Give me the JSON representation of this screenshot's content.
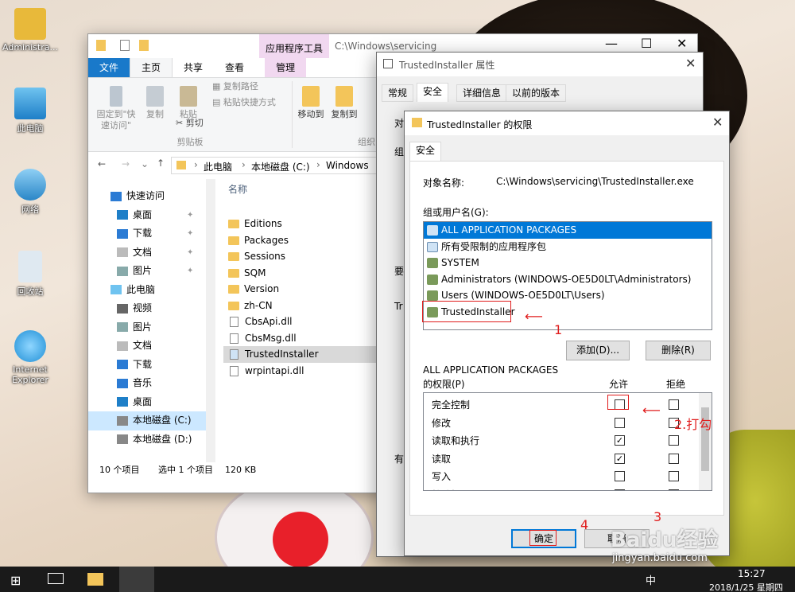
{
  "desktop": {
    "icons": [
      {
        "label": "Administra...",
        "icon": "user-folder-icon"
      },
      {
        "label": "此电脑",
        "icon": "computer-icon"
      },
      {
        "label": "网络",
        "icon": "network-icon"
      },
      {
        "label": "回收站",
        "icon": "recycle-bin-icon"
      },
      {
        "label": "Internet Explorer",
        "icon": "ie-icon"
      }
    ]
  },
  "explorer": {
    "contextual_tab": "应用程序工具",
    "path_title": "C:\\Windows\\servicing",
    "tabs": [
      "文件",
      "主页",
      "共享",
      "查看",
      "管理"
    ],
    "ribbon": {
      "pin_quick": "固定到\"快速访问\"",
      "copy": "复制",
      "paste": "粘贴",
      "copy_path": "复制路径",
      "paste_shortcut": "粘贴快捷方式",
      "cut": "剪切",
      "clipboard_group": "剪贴板",
      "move_to": "移动到",
      "copy_to": "复制到",
      "organize_group": "组织"
    },
    "breadcrumb": [
      "此电脑",
      "本地磁盘 (C:)",
      "Windows"
    ],
    "nav": [
      {
        "label": "快速访问",
        "icon": "star-icon"
      },
      {
        "label": "桌面",
        "icon": "desktop-icon"
      },
      {
        "label": "下载",
        "icon": "download-icon"
      },
      {
        "label": "文档",
        "icon": "document-icon"
      },
      {
        "label": "图片",
        "icon": "picture-icon"
      },
      {
        "label": "此电脑",
        "icon": "computer-icon"
      },
      {
        "label": "视频",
        "icon": "video-icon"
      },
      {
        "label": "图片",
        "icon": "picture-icon"
      },
      {
        "label": "文档",
        "icon": "document-icon"
      },
      {
        "label": "下载",
        "icon": "download-icon"
      },
      {
        "label": "音乐",
        "icon": "music-icon"
      },
      {
        "label": "桌面",
        "icon": "desktop-icon"
      },
      {
        "label": "本地磁盘 (C:)",
        "icon": "drive-icon"
      },
      {
        "label": "本地磁盘 (D:)",
        "icon": "drive-icon"
      }
    ],
    "column_name": "名称",
    "files": [
      {
        "name": "Editions",
        "type": "folder"
      },
      {
        "name": "Packages",
        "type": "folder"
      },
      {
        "name": "Sessions",
        "type": "folder"
      },
      {
        "name": "SQM",
        "type": "folder"
      },
      {
        "name": "Version",
        "type": "folder"
      },
      {
        "name": "zh-CN",
        "type": "folder"
      },
      {
        "name": "CbsApi.dll",
        "type": "file"
      },
      {
        "name": "CbsMsg.dll",
        "type": "file"
      },
      {
        "name": "TrustedInstaller",
        "type": "exe"
      },
      {
        "name": "wrpintapi.dll",
        "type": "file"
      }
    ],
    "status": {
      "count": "10 个项目",
      "selected": "选中 1 个项目",
      "size": "120 KB"
    }
  },
  "props": {
    "title": "TrustedInstaller 属性",
    "tabs": [
      "常规",
      "安全",
      "详细信息",
      "以前的版本"
    ],
    "partial": [
      "对",
      "组",
      "要",
      "Tr",
      "有"
    ]
  },
  "perm": {
    "title": "TrustedInstaller 的权限",
    "tab": "安全",
    "object_label": "对象名称:",
    "object_value": "C:\\Windows\\servicing\\TrustedInstaller.exe",
    "group_label": "组或用户名(G):",
    "users": [
      "ALL APPLICATION PACKAGES",
      "所有受限制的应用程序包",
      "SYSTEM",
      "Administrators (WINDOWS-OE5D0LT\\Administrators)",
      "Users (WINDOWS-OE5D0LT\\Users)",
      "TrustedInstaller"
    ],
    "add_button": "添加(D)...",
    "remove_button": "删除(R)",
    "perm_for": "ALL APPLICATION PACKAGES",
    "perm_label": "的权限(P)",
    "allow": "允许",
    "deny": "拒绝",
    "rows": [
      {
        "name": "完全控制",
        "allow": false,
        "deny": false
      },
      {
        "name": "修改",
        "allow": false,
        "deny": false
      },
      {
        "name": "读取和执行",
        "allow": true,
        "deny": false
      },
      {
        "name": "读取",
        "allow": true,
        "deny": false
      },
      {
        "name": "写入",
        "allow": false,
        "deny": false
      },
      {
        "name": "特殊权限",
        "allow": false,
        "deny": false
      }
    ],
    "ok_button": "确定",
    "cancel_button": "取消"
  },
  "annotations": [
    "1",
    "2.打勾",
    "3",
    "4"
  ],
  "watermark": {
    "brand": "Baidu经验",
    "url": "jingyan.baidu.com"
  },
  "taskbar": {
    "ime": "中",
    "time": "15:27",
    "date": "2018/1/25 星期四"
  },
  "colors": {
    "accent": "#0078d7",
    "file_tab": "#1979ca",
    "annotation": "#e01d1d",
    "contextual_tab_bg": "#f1d8f0"
  }
}
